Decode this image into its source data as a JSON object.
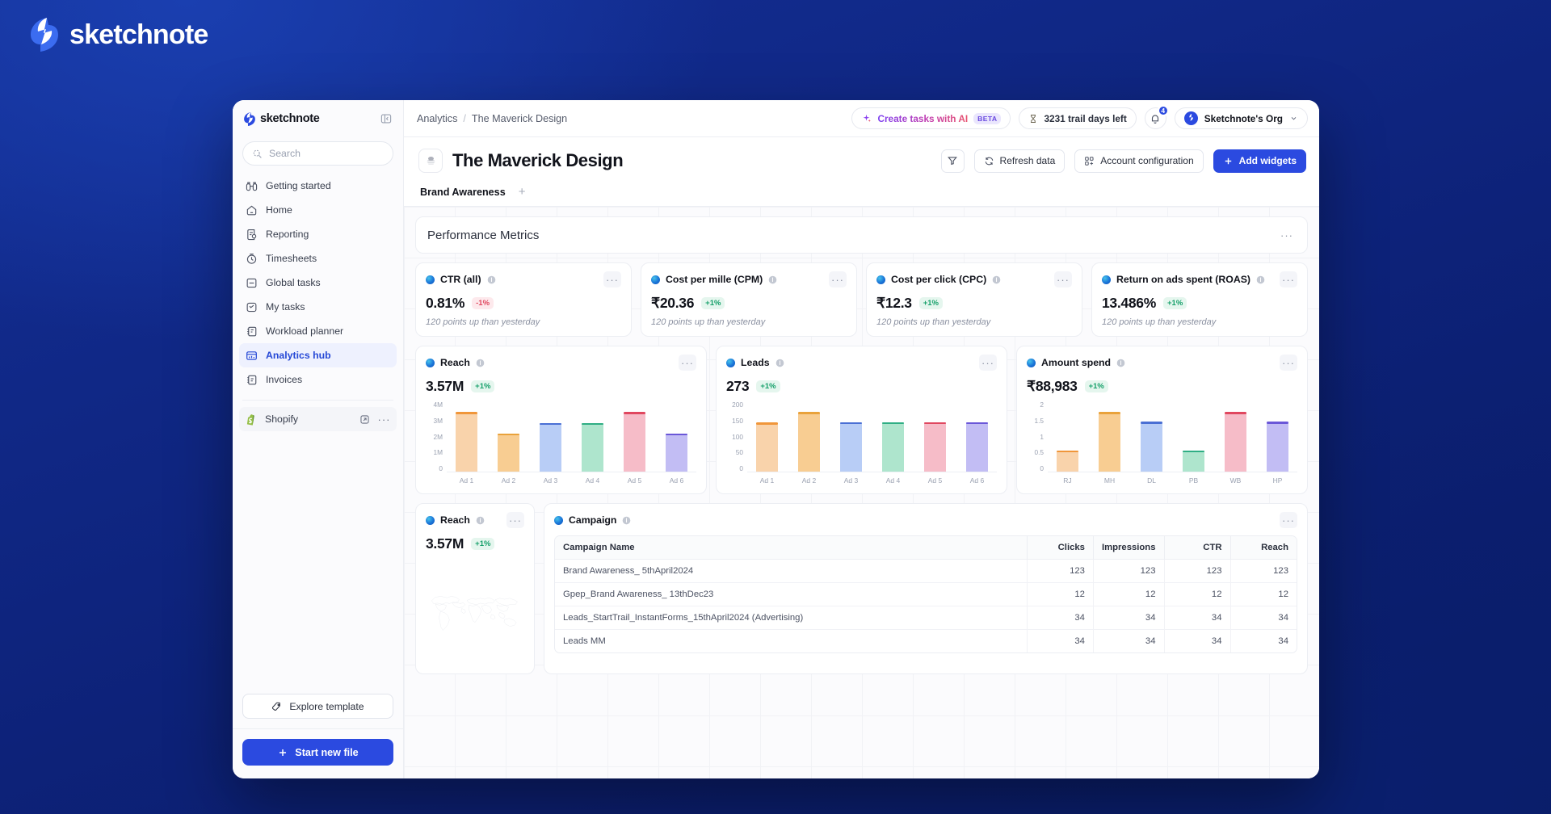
{
  "brand": {
    "name": "sketchnote",
    "logo_icon": "bolt-icon"
  },
  "sidebar": {
    "app_name": "sketchnote",
    "collapse_icon": "collapse-panel-icon",
    "search": {
      "placeholder": "Search",
      "icon": "search-icon"
    },
    "items": [
      {
        "label": "Getting started",
        "icon": "binoculars-icon",
        "active": false
      },
      {
        "label": "Home",
        "icon": "home-icon",
        "active": false
      },
      {
        "label": "Reporting",
        "icon": "report-icon",
        "active": false
      },
      {
        "label": "Timesheets",
        "icon": "timer-icon",
        "active": false
      },
      {
        "label": "Global tasks",
        "icon": "global-tasks-icon",
        "active": false
      },
      {
        "label": "My tasks",
        "icon": "my-tasks-icon",
        "active": false
      },
      {
        "label": "Workload planner",
        "icon": "workload-icon",
        "active": false
      },
      {
        "label": "Analytics hub",
        "icon": "analytics-icon",
        "active": true
      },
      {
        "label": "Invoices",
        "icon": "invoice-icon",
        "active": false
      }
    ],
    "app_entry": {
      "label": "Shopify",
      "icon": "shopify-icon",
      "open_icon": "external-link-icon",
      "more_icon": "more-icon"
    },
    "explore_template": {
      "label": "Explore template",
      "icon": "template-icon"
    },
    "start_new_file": {
      "label": "Start new file",
      "icon": "plus-icon"
    }
  },
  "topbar": {
    "breadcrumb_root": "Analytics",
    "breadcrumb_sep": "/",
    "breadcrumb_current": "The Maverick Design",
    "ai_button": {
      "label": "Create tasks with AI",
      "badge": "BETA",
      "icon": "sparkles-icon"
    },
    "trial": {
      "label": "3231 trail days left",
      "icon": "hourglass-icon"
    },
    "notifications": {
      "count": "4",
      "icon": "bell-icon"
    },
    "org": {
      "name": "Sketchnote's Org",
      "chevron_icon": "chevron-down-icon",
      "avatar_icon": "bolt-icon"
    }
  },
  "header": {
    "title": "The Maverick Design",
    "avatar_icon": "project-avatar-icon",
    "filter_button": {
      "label": "",
      "icon": "filter-icon"
    },
    "refresh_button": {
      "label": "Refresh data",
      "icon": "refresh-icon"
    },
    "account_button": {
      "label": "Account configuration",
      "icon": "grid-plus-icon"
    },
    "add_widgets_button": {
      "label": "Add widgets",
      "icon": "plus-icon"
    }
  },
  "tabs": [
    {
      "label": "Brand Awareness",
      "active": true
    }
  ],
  "tab_add_icon": "plus-icon",
  "section": {
    "title": "Performance Metrics",
    "more_icon": "more-icon"
  },
  "kpis": [
    {
      "name": "CTR (all)",
      "value": "0.81%",
      "delta": "-1%",
      "delta_dir": "down",
      "sub": "120 points up than yesterday"
    },
    {
      "name": "Cost per mille (CPM)",
      "value": "₹20.36",
      "delta": "+1%",
      "delta_dir": "up",
      "sub": "120 points up than yesterday"
    },
    {
      "name": "Cost per click (CPC)",
      "value": "₹12.3",
      "delta": "+1%",
      "delta_dir": "up",
      "sub": "120 points up than yesterday"
    },
    {
      "name": "Return on ads spent (ROAS)",
      "value": "13.486%",
      "delta": "+1%",
      "delta_dir": "up",
      "sub": "120 points up than yesterday"
    }
  ],
  "map_widget": {
    "name": "Reach",
    "value": "3.57M",
    "delta": "+1%",
    "delta_dir": "up",
    "icon": "world-map-icon"
  },
  "table_widget": {
    "name": "Campaign",
    "columns": [
      "Campaign Name",
      "Clicks",
      "Impressions",
      "CTR",
      "Reach"
    ],
    "rows": [
      {
        "name": "Brand Awareness_ 5thApril2024",
        "clicks": "123",
        "impressions": "123",
        "ctr": "123",
        "reach": "123"
      },
      {
        "name": "Gpep_Brand Awareness_ 13thDec23",
        "clicks": "12",
        "impressions": "12",
        "ctr": "12",
        "reach": "12"
      },
      {
        "name": "Leads_StartTrail_InstantForms_15thApril2024 (Advertising)",
        "clicks": "34",
        "impressions": "34",
        "ctr": "34",
        "reach": "34"
      },
      {
        "name": "Leads MM",
        "clicks": "34",
        "impressions": "34",
        "ctr": "34",
        "reach": "34"
      }
    ]
  },
  "chart_data": [
    {
      "type": "bar",
      "widget_name": "Reach",
      "summary_value": "3.57M",
      "summary_delta": "+1%",
      "title": "Reach",
      "xlabel": "",
      "ylabel": "",
      "categories": [
        "Ad 1",
        "Ad 2",
        "Ad 3",
        "Ad 4",
        "Ad 5",
        "Ad 6"
      ],
      "values": [
        3.35,
        2.15,
        2.75,
        2.75,
        3.35,
        2.15
      ],
      "ylim": [
        0,
        4
      ],
      "yticks": [
        "4M",
        "3M",
        "2M",
        "1M",
        "0"
      ],
      "unit": "M",
      "grid": false,
      "legend": "none",
      "bar_colors": [
        "#f9d3ab",
        "#f8cd92",
        "#b8cdf6",
        "#aee5cd",
        "#f6bcc8",
        "#c2bdf4"
      ],
      "cap_colors": [
        "#f0963a",
        "#e9a23b",
        "#4a6fd4",
        "#2fae84",
        "#e0475f",
        "#6a57d8"
      ]
    },
    {
      "type": "bar",
      "widget_name": "Leads",
      "summary_value": "273",
      "summary_delta": "+1%",
      "title": "Leads",
      "xlabel": "",
      "ylabel": "",
      "categories": [
        "Ad 1",
        "Ad 2",
        "Ad 3",
        "Ad 4",
        "Ad 5",
        "Ad 6"
      ],
      "values": [
        138,
        168,
        139,
        139,
        139,
        139
      ],
      "ylim": [
        0,
        200
      ],
      "yticks": [
        "200",
        "150",
        "100",
        "50",
        "0"
      ],
      "unit": "",
      "grid": false,
      "legend": "none",
      "bar_colors": [
        "#f9d3ab",
        "#f8cd92",
        "#b8cdf6",
        "#aee5cd",
        "#f6bcc8",
        "#c2bdf4"
      ],
      "cap_colors": [
        "#f0963a",
        "#e9a23b",
        "#4a6fd4",
        "#2fae84",
        "#e0475f",
        "#6a57d8"
      ]
    },
    {
      "type": "bar",
      "widget_name": "Amount spend",
      "summary_value": "₹88,983",
      "summary_delta": "+1%",
      "title": "Amount spend",
      "xlabel": "",
      "ylabel": "",
      "categories": [
        "RJ",
        "MH",
        "DL",
        "PB",
        "WB",
        "HP"
      ],
      "values": [
        0.6,
        1.68,
        1.4,
        0.6,
        1.68,
        1.4
      ],
      "ylim": [
        0,
        2
      ],
      "yticks": [
        "2",
        "1.5",
        "1",
        "0.5",
        "0"
      ],
      "unit": "",
      "grid": false,
      "legend": "none",
      "bar_colors": [
        "#f9d3ab",
        "#f8cd92",
        "#b8cdf6",
        "#aee5cd",
        "#f6bcc8",
        "#c2bdf4"
      ],
      "cap_colors": [
        "#f0963a",
        "#e9a23b",
        "#4a6fd4",
        "#2fae84",
        "#e0475f",
        "#6a57d8"
      ]
    }
  ],
  "colors": {
    "accent": "#2b4ae0",
    "up": "#16a06a",
    "down": "#e0475f",
    "canvas_bg": "#0f2a8f"
  }
}
